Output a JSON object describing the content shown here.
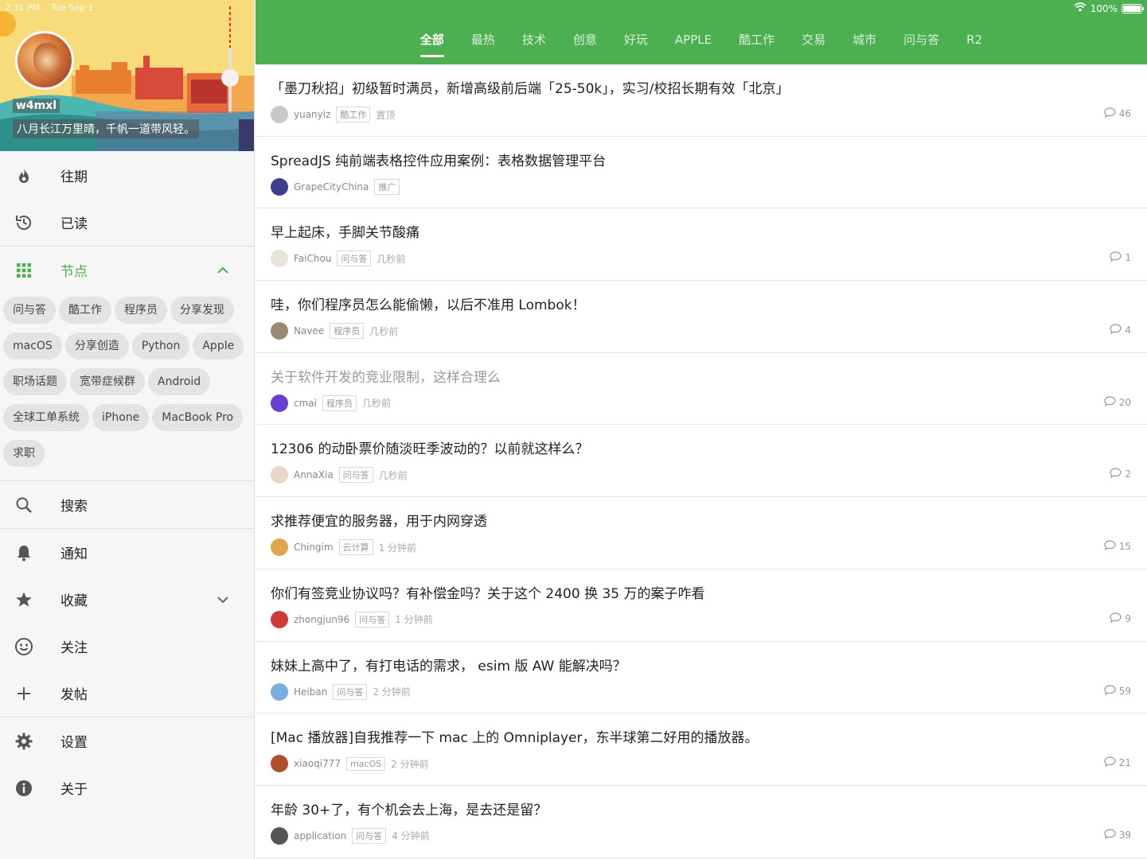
{
  "status": {
    "time": "2:31 PM",
    "date": "Tue Sep 1",
    "battery": "100%"
  },
  "profile": {
    "username": "w4mxl",
    "motto": "八月长江万里晴，千帆一道带风轻。"
  },
  "sidebar": {
    "top_items": [
      {
        "label": "往期",
        "icon": "fire-icon"
      },
      {
        "label": "已读",
        "icon": "history-icon"
      }
    ],
    "nodes_label": "节点",
    "nodes": [
      "问与答",
      "酷工作",
      "程序员",
      "分享发现",
      "macOS",
      "分享创造",
      "Python",
      "Apple",
      "职场话题",
      "宽带症候群",
      "Android",
      "全球工单系统",
      "iPhone",
      "MacBook Pro",
      "求职"
    ],
    "bottom_items": [
      {
        "label": "搜索",
        "icon": "search-icon"
      },
      {
        "label": "通知",
        "icon": "bell-icon"
      },
      {
        "label": "收藏",
        "icon": "star-icon"
      },
      {
        "label": "关注",
        "icon": "smile-icon"
      },
      {
        "label": "发帖",
        "icon": "plus-icon"
      },
      {
        "label": "设置",
        "icon": "gear-icon"
      },
      {
        "label": "关于",
        "icon": "info-icon"
      }
    ]
  },
  "tabs": [
    "全部",
    "最热",
    "技术",
    "创意",
    "好玩",
    "APPLE",
    "酷工作",
    "交易",
    "城市",
    "问与答",
    "R2"
  ],
  "active_tab": "全部",
  "topics": [
    {
      "title": "「墨刀秋招」初级暂时满员，新增高级前后端「25-50k」，实习/校招长期有效「北京」",
      "author": "yuanyiz",
      "node": "酷工作",
      "time": "置顶",
      "replies": "46",
      "avatar_color": "#c8c8c8",
      "read": false
    },
    {
      "title": "SpreadJS 纯前端表格控件应用案例：表格数据管理平台",
      "author": "GrapeCityChina",
      "node": "推广",
      "time": "",
      "replies": "",
      "avatar_color": "#3b3f8c",
      "read": false
    },
    {
      "title": "早上起床，手脚关节酸痛",
      "author": "FaiChou",
      "node": "问与答",
      "time": "几秒前",
      "replies": "1",
      "avatar_color": "#e8e4da",
      "read": false
    },
    {
      "title": "哇，你们程序员怎么能偷懒，以后不准用 Lombok！",
      "author": "Navee",
      "node": "程序员",
      "time": "几秒前",
      "replies": "4",
      "avatar_color": "#9a8a74",
      "read": false
    },
    {
      "title": "关于软件开发的竞业限制，这样合理么",
      "author": "cmai",
      "node": "程序员",
      "time": "几秒前",
      "replies": "20",
      "avatar_color": "#6a3fd0",
      "read": true
    },
    {
      "title": "12306 的动卧票价随淡旺季波动的？以前就这样么？",
      "author": "AnnaXia",
      "node": "问与答",
      "time": "几秒前",
      "replies": "2",
      "avatar_color": "#e9d6c8",
      "read": false
    },
    {
      "title": "求推荐便宜的服务器，用于内网穿透",
      "author": "Chingim",
      "node": "云计算",
      "time": "1 分钟前",
      "replies": "15",
      "avatar_color": "#e0a550",
      "read": false
    },
    {
      "title": "你们有签竞业协议吗？有补偿金吗？关于这个 2400 换 35 万的案子咋看",
      "author": "zhongjun96",
      "node": "问与答",
      "time": "1 分钟前",
      "replies": "9",
      "avatar_color": "#d03a3a",
      "read": false
    },
    {
      "title": "妹妹上高中了，有打电话的需求， esim 版 AW 能解决吗？",
      "author": "Heiban",
      "node": "问与答",
      "time": "2 分钟前",
      "replies": "59",
      "avatar_color": "#7aaee0",
      "read": false
    },
    {
      "title": "[Mac 播放器]自我推荐一下 mac 上的 Omniplayer，东半球第二好用的播放器。",
      "author": "xiaoqi777",
      "node": "macOS",
      "time": "2 分钟前",
      "replies": "21",
      "avatar_color": "#b0502a",
      "read": false
    },
    {
      "title": "年龄 30+了，有个机会去上海，是去还是留？",
      "author": "application",
      "node": "问与答",
      "time": "4 分钟前",
      "replies": "39",
      "avatar_color": "#555555",
      "read": false
    }
  ],
  "colors": {
    "accent": "#4caf50",
    "sidebar_bg": "#f6f6f6"
  }
}
